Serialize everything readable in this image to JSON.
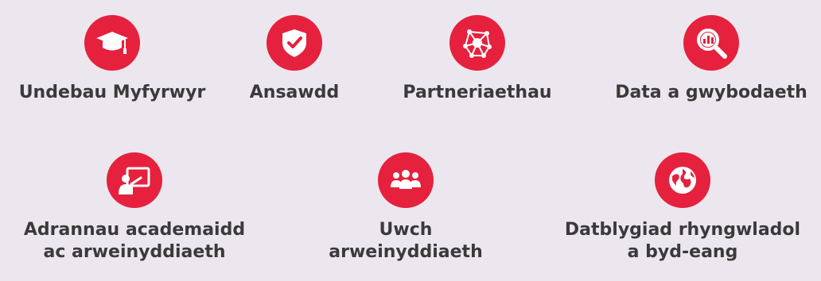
{
  "colors": {
    "background": "#ece7ee",
    "accent": "#e5213e",
    "text": "#3a3a3a"
  },
  "row1": [
    {
      "icon": "graduation-cap-icon",
      "label": "Undebau Myfyrwyr"
    },
    {
      "icon": "shield-check-icon",
      "label": "Ansawdd"
    },
    {
      "icon": "network-icon",
      "label": "Partneriaethau"
    },
    {
      "icon": "magnifier-chart-icon",
      "label": "Data a gwybodaeth"
    }
  ],
  "row2": [
    {
      "icon": "teacher-board-icon",
      "line1": "Adrannau academaidd",
      "line2": "ac arweinyddiaeth"
    },
    {
      "icon": "group-icon",
      "line1": "Uwch",
      "line2": "arweinyddiaeth"
    },
    {
      "icon": "globe-icon",
      "line1": "Datblygiad rhyngwladol",
      "line2": "a byd-eang"
    }
  ]
}
